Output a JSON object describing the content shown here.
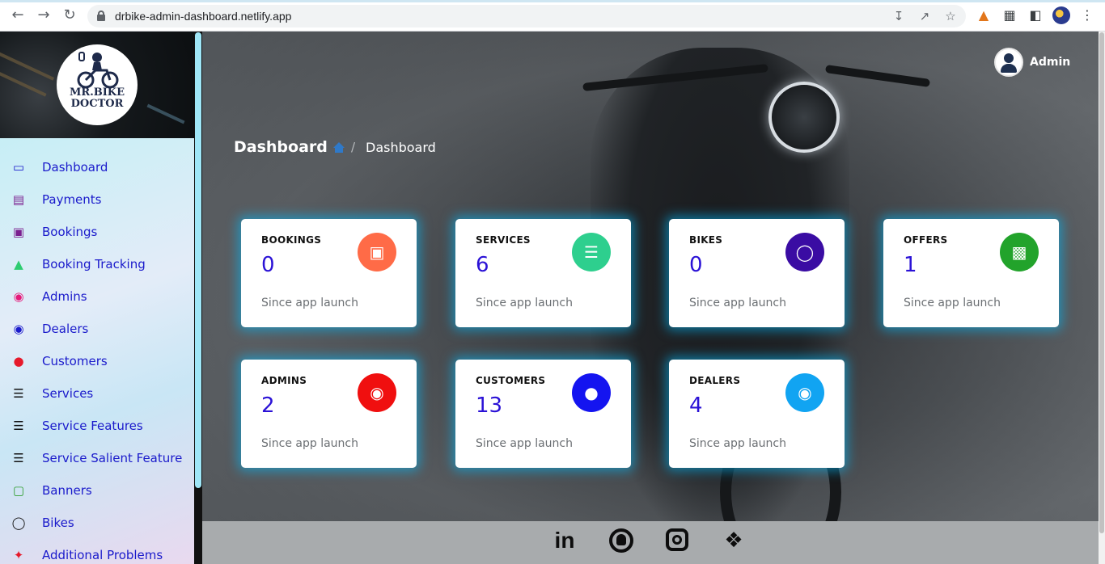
{
  "browser": {
    "url": "drbike-admin-dashboard.netlify.app",
    "back_icon": "arrow-left-icon",
    "forward_icon": "arrow-right-icon",
    "reload_icon": "reload-icon"
  },
  "sidebar": {
    "logo_line1": "MR.BIKE",
    "logo_line2": "DOCTOR",
    "items": [
      {
        "label": "Dashboard",
        "icon": "monitor-icon",
        "color": "#1a1acb"
      },
      {
        "label": "Payments",
        "icon": "money-icon",
        "color": "#7b1f8f"
      },
      {
        "label": "Bookings",
        "icon": "shopping-bag-icon",
        "color": "#7b1f8f"
      },
      {
        "label": "Booking Tracking",
        "icon": "road-icon",
        "color": "#2ecc71"
      },
      {
        "label": "Admins",
        "icon": "user-secret-icon",
        "color": "#e6197a"
      },
      {
        "label": "Dealers",
        "icon": "user-circle-icon",
        "color": "#1a1acb"
      },
      {
        "label": "Customers",
        "icon": "users-icon",
        "color": "#e6192b"
      },
      {
        "label": "Services",
        "icon": "list-icon",
        "color": "#111111"
      },
      {
        "label": "Service Features",
        "icon": "list-icon",
        "color": "#111111"
      },
      {
        "label": "Service Salient Feature",
        "icon": "list-icon",
        "color": "#111111"
      },
      {
        "label": "Banners",
        "icon": "image-icon",
        "color": "#2e9e2e"
      },
      {
        "label": "Bikes",
        "icon": "motorcycle-icon",
        "color": "#111111"
      },
      {
        "label": "Additional Problems",
        "icon": "wrench-icon",
        "color": "#e6192b"
      }
    ]
  },
  "header": {
    "user_name": "Admin",
    "page_title": "Dashboard",
    "breadcrumb_current": "Dashboard",
    "breadcrumb_separator": "/"
  },
  "cards": [
    {
      "label": "BOOKINGS",
      "value": "0",
      "note": "Since app launch",
      "icon": "shopping-bag-icon",
      "color": "#ff6b47"
    },
    {
      "label": "SERVICES",
      "value": "6",
      "note": "Since app launch",
      "icon": "list-icon",
      "color": "#2ecf8e"
    },
    {
      "label": "BIKES",
      "value": "0",
      "note": "Since app launch",
      "icon": "motorcycle-icon",
      "color": "#3a0ca3"
    },
    {
      "label": "OFFERS",
      "value": "1",
      "note": "Since app launch",
      "icon": "gift-icon",
      "color": "#22a32b"
    },
    {
      "label": "ADMINS",
      "value": "2",
      "note": "Since app launch",
      "icon": "user-secret-icon",
      "color": "#f00f0f"
    },
    {
      "label": "CUSTOMERS",
      "value": "13",
      "note": "Since app launch",
      "icon": "users-icon",
      "color": "#1414f0"
    },
    {
      "label": "DEALERS",
      "value": "4",
      "note": "Since app launch",
      "icon": "user-circle-icon",
      "color": "#11a4f2"
    }
  ],
  "footer": {
    "linkedin_label": "in",
    "icons": [
      "linkedin-icon",
      "github-icon",
      "instagram-icon",
      "twitter-icon"
    ]
  }
}
